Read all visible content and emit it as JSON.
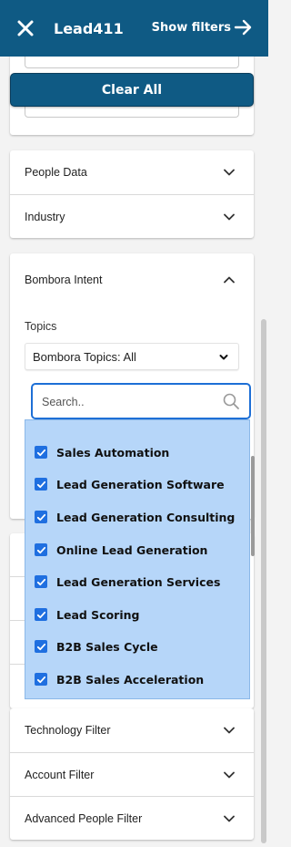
{
  "header": {
    "title": "Lead411",
    "show_filters_label": "Show filters"
  },
  "clear_all_label": "Clear All",
  "filters_top": [
    {
      "label": "People Data"
    },
    {
      "label": "Industry"
    }
  ],
  "bombora": {
    "title": "Bombora Intent",
    "topics_label": "Topics",
    "topics_select_value": "Bombora Topics: All",
    "search_placeholder": "Search..",
    "options": [
      {
        "label": "Sales Automation",
        "checked": true
      },
      {
        "label": "Lead Generation Software",
        "checked": true
      },
      {
        "label": "Lead Generation Consulting",
        "checked": true
      },
      {
        "label": "Online Lead Generation",
        "checked": true
      },
      {
        "label": "Lead Generation Services",
        "checked": true
      },
      {
        "label": "Lead Scoring",
        "checked": true
      },
      {
        "label": "B2B Sales Cycle",
        "checked": true
      },
      {
        "label": "B2B Sales Acceleration",
        "checked": true
      }
    ]
  },
  "filters_bottom": [
    {
      "label": "Technology Filter"
    },
    {
      "label": "Account Filter"
    },
    {
      "label": "Advanced People Filter"
    }
  ],
  "colors": {
    "header_bg": "#0f5a84",
    "option_bg": "#b6d6f9",
    "checkbox": "#1f6fe0",
    "search_border": "#1d6fd6"
  }
}
